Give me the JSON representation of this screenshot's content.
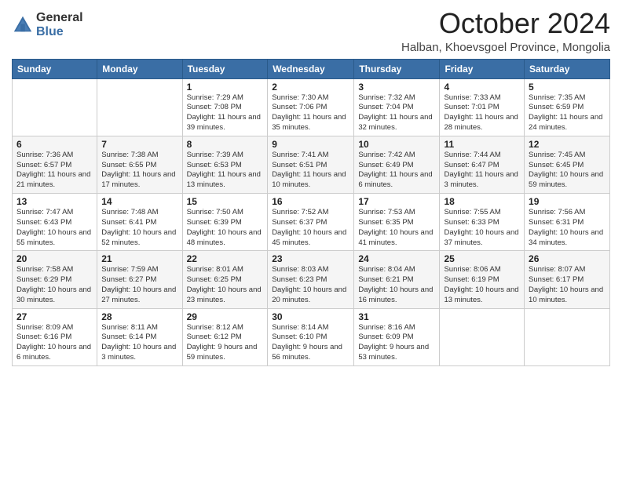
{
  "logo": {
    "general": "General",
    "blue": "Blue"
  },
  "header": {
    "month": "October 2024",
    "location": "Halban, Khoevsgoel Province, Mongolia"
  },
  "weekdays": [
    "Sunday",
    "Monday",
    "Tuesday",
    "Wednesday",
    "Thursday",
    "Friday",
    "Saturday"
  ],
  "weeks": [
    [
      {
        "day": "",
        "info": ""
      },
      {
        "day": "",
        "info": ""
      },
      {
        "day": "1",
        "info": "Sunrise: 7:29 AM\nSunset: 7:08 PM\nDaylight: 11 hours and 39 minutes."
      },
      {
        "day": "2",
        "info": "Sunrise: 7:30 AM\nSunset: 7:06 PM\nDaylight: 11 hours and 35 minutes."
      },
      {
        "day": "3",
        "info": "Sunrise: 7:32 AM\nSunset: 7:04 PM\nDaylight: 11 hours and 32 minutes."
      },
      {
        "day": "4",
        "info": "Sunrise: 7:33 AM\nSunset: 7:01 PM\nDaylight: 11 hours and 28 minutes."
      },
      {
        "day": "5",
        "info": "Sunrise: 7:35 AM\nSunset: 6:59 PM\nDaylight: 11 hours and 24 minutes."
      }
    ],
    [
      {
        "day": "6",
        "info": "Sunrise: 7:36 AM\nSunset: 6:57 PM\nDaylight: 11 hours and 21 minutes."
      },
      {
        "day": "7",
        "info": "Sunrise: 7:38 AM\nSunset: 6:55 PM\nDaylight: 11 hours and 17 minutes."
      },
      {
        "day": "8",
        "info": "Sunrise: 7:39 AM\nSunset: 6:53 PM\nDaylight: 11 hours and 13 minutes."
      },
      {
        "day": "9",
        "info": "Sunrise: 7:41 AM\nSunset: 6:51 PM\nDaylight: 11 hours and 10 minutes."
      },
      {
        "day": "10",
        "info": "Sunrise: 7:42 AM\nSunset: 6:49 PM\nDaylight: 11 hours and 6 minutes."
      },
      {
        "day": "11",
        "info": "Sunrise: 7:44 AM\nSunset: 6:47 PM\nDaylight: 11 hours and 3 minutes."
      },
      {
        "day": "12",
        "info": "Sunrise: 7:45 AM\nSunset: 6:45 PM\nDaylight: 10 hours and 59 minutes."
      }
    ],
    [
      {
        "day": "13",
        "info": "Sunrise: 7:47 AM\nSunset: 6:43 PM\nDaylight: 10 hours and 55 minutes."
      },
      {
        "day": "14",
        "info": "Sunrise: 7:48 AM\nSunset: 6:41 PM\nDaylight: 10 hours and 52 minutes."
      },
      {
        "day": "15",
        "info": "Sunrise: 7:50 AM\nSunset: 6:39 PM\nDaylight: 10 hours and 48 minutes."
      },
      {
        "day": "16",
        "info": "Sunrise: 7:52 AM\nSunset: 6:37 PM\nDaylight: 10 hours and 45 minutes."
      },
      {
        "day": "17",
        "info": "Sunrise: 7:53 AM\nSunset: 6:35 PM\nDaylight: 10 hours and 41 minutes."
      },
      {
        "day": "18",
        "info": "Sunrise: 7:55 AM\nSunset: 6:33 PM\nDaylight: 10 hours and 37 minutes."
      },
      {
        "day": "19",
        "info": "Sunrise: 7:56 AM\nSunset: 6:31 PM\nDaylight: 10 hours and 34 minutes."
      }
    ],
    [
      {
        "day": "20",
        "info": "Sunrise: 7:58 AM\nSunset: 6:29 PM\nDaylight: 10 hours and 30 minutes."
      },
      {
        "day": "21",
        "info": "Sunrise: 7:59 AM\nSunset: 6:27 PM\nDaylight: 10 hours and 27 minutes."
      },
      {
        "day": "22",
        "info": "Sunrise: 8:01 AM\nSunset: 6:25 PM\nDaylight: 10 hours and 23 minutes."
      },
      {
        "day": "23",
        "info": "Sunrise: 8:03 AM\nSunset: 6:23 PM\nDaylight: 10 hours and 20 minutes."
      },
      {
        "day": "24",
        "info": "Sunrise: 8:04 AM\nSunset: 6:21 PM\nDaylight: 10 hours and 16 minutes."
      },
      {
        "day": "25",
        "info": "Sunrise: 8:06 AM\nSunset: 6:19 PM\nDaylight: 10 hours and 13 minutes."
      },
      {
        "day": "26",
        "info": "Sunrise: 8:07 AM\nSunset: 6:17 PM\nDaylight: 10 hours and 10 minutes."
      }
    ],
    [
      {
        "day": "27",
        "info": "Sunrise: 8:09 AM\nSunset: 6:16 PM\nDaylight: 10 hours and 6 minutes."
      },
      {
        "day": "28",
        "info": "Sunrise: 8:11 AM\nSunset: 6:14 PM\nDaylight: 10 hours and 3 minutes."
      },
      {
        "day": "29",
        "info": "Sunrise: 8:12 AM\nSunset: 6:12 PM\nDaylight: 9 hours and 59 minutes."
      },
      {
        "day": "30",
        "info": "Sunrise: 8:14 AM\nSunset: 6:10 PM\nDaylight: 9 hours and 56 minutes."
      },
      {
        "day": "31",
        "info": "Sunrise: 8:16 AM\nSunset: 6:09 PM\nDaylight: 9 hours and 53 minutes."
      },
      {
        "day": "",
        "info": ""
      },
      {
        "day": "",
        "info": ""
      }
    ]
  ]
}
